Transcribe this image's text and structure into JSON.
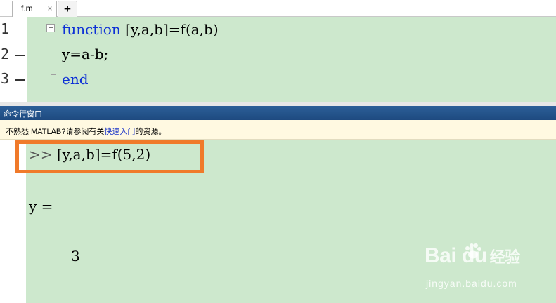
{
  "tabs": [
    {
      "label": "f.m",
      "close_glyph": "×"
    }
  ],
  "add_tab_glyph": "+",
  "editor": {
    "line_numbers": [
      "1",
      "2",
      "3"
    ],
    "line1_keyword": "function",
    "line1_rest": " [y,a,b]=f(a,b)",
    "line2": "y=a-b;",
    "line3_keyword": "end"
  },
  "command_window": {
    "title": "命令行窗口",
    "info_prefix": "不熟悉 MATLAB?请参阅有关",
    "info_link": "快速入门",
    "info_suffix": "的资源。",
    "prompt": ">>",
    "command": " [y,a,b]=f(5,2)",
    "output_var": "y =",
    "output_value": "3"
  },
  "watermark": {
    "brand": "Bai du",
    "brand_cn": "经验",
    "url": "jingyan.baidu.com"
  },
  "colors": {
    "code_bg": "#cde8cd",
    "keyword": "#0e31d6",
    "header_bg": "#1e4a80",
    "info_bg": "#fff9e1",
    "highlight": "#f07a2a"
  }
}
